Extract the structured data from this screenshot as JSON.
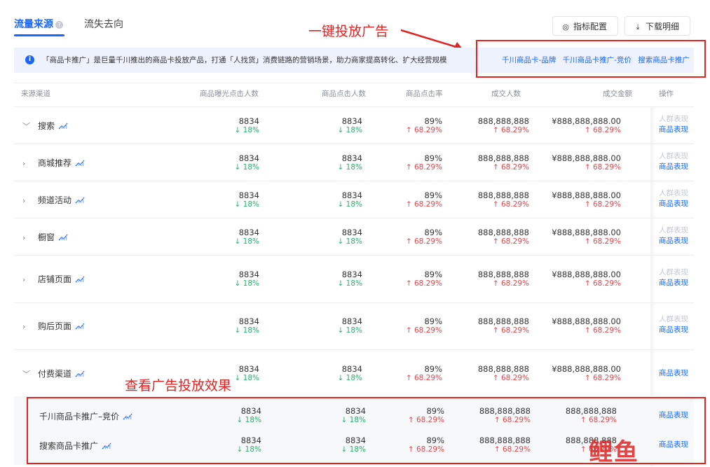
{
  "tabs": [
    {
      "label": "流量来源",
      "active": true
    },
    {
      "label": "流失去向",
      "active": false
    }
  ],
  "toolbar": {
    "metric_label": "指标配置",
    "download_label": "下载明细"
  },
  "annotations": {
    "top": "一键投放广告",
    "bottom": "查看广告投放效果"
  },
  "banner": {
    "text": "「商品卡推广」是巨量千川推出的商品卡投放产品，打通「人找货」消费链路的营销场景，助力商家提高转化、扩大经营规模",
    "links": [
      "千川商品卡-品牌",
      "千川商品卡推广-竞价",
      "搜索商品卡推广"
    ]
  },
  "columns": [
    "来源渠道",
    "商品曝光点击人数",
    "商品点击人数",
    "商品点击率",
    "成交人数",
    "成交金额",
    "操作"
  ],
  "ops": {
    "crowd": "人群表现",
    "product": "商品表现"
  },
  "rows": [
    {
      "name": "搜索",
      "expanded": true,
      "c1": "8834",
      "c1d": "↓ 18%",
      "c2": "8834",
      "c2d": "↓ 18%",
      "c3": "89%",
      "c3d": "↑ 68.29%",
      "c4": "888,888,888",
      "c4d": "↑ 68.29%",
      "c5": "¥888,888,888.00",
      "c5d": "↑ 68.29%"
    },
    {
      "name": "商城推荐",
      "expanded": false,
      "c1": "8834",
      "c1d": "↓ 18%",
      "c2": "8834",
      "c2d": "↓ 18%",
      "c3": "89%",
      "c3d": "↑ 68.29%",
      "c4": "888,888,888",
      "c4d": "↑ 68.29%",
      "c5": "¥888,888,888.00",
      "c5d": "↑ 68.29%"
    },
    {
      "name": "频道活动",
      "expanded": false,
      "c1": "8834",
      "c1d": "↓ 18%",
      "c2": "8834",
      "c2d": "↓ 18%",
      "c3": "89%",
      "c3d": "↑ 68.29%",
      "c4": "888,888,888",
      "c4d": "↑ 68.29%",
      "c5": "¥888,888,888.00",
      "c5d": "↑ 68.29%"
    },
    {
      "name": "橱窗",
      "expanded": false,
      "c1": "8834",
      "c1d": "↓ 18%",
      "c2": "8834",
      "c2d": "↓ 18%",
      "c3": "89%",
      "c3d": "↑ 68.29%",
      "c4": "888,888,888",
      "c4d": "↑ 68.29%",
      "c5": "¥888,888,888.00",
      "c5d": "↑ 68.29%"
    },
    {
      "name": "店铺页面",
      "expanded": false,
      "c1": "8834",
      "c1d": "↓ 18%",
      "c2": "8834",
      "c2d": "↓ 18%",
      "c3": "89%",
      "c3d": "↑ 68.29%",
      "c4": "888,888,888",
      "c4d": "↑ 68.29%",
      "c5": "¥888,888,888.00",
      "c5d": "↑ 68.29%"
    },
    {
      "name": "购后页面",
      "expanded": false,
      "c1": "8834",
      "c1d": "↓ 18%",
      "c2": "8834",
      "c2d": "↓ 18%",
      "c3": "89%",
      "c3d": "↑ 68.29%",
      "c4": "888,888,888",
      "c4d": "↑ 68.29%",
      "c5": "¥888,888,888.00",
      "c5d": "↑ 68.29%"
    },
    {
      "name": "付费渠道",
      "expanded": true,
      "c1": "8834",
      "c1d": "↓ 18%",
      "c2": "8834",
      "c2d": "↓ 18%",
      "c3": "89%",
      "c3d": "↑ 68.29%",
      "c4": "888,888,888",
      "c4d": "↑ 68.29%",
      "c5": "¥888,888,888.00",
      "c5d": "↑ 68.29%"
    }
  ],
  "subrows": [
    {
      "name": "千川商品卡推广–竞价",
      "c1": "8834",
      "c1d": "↓ 18%",
      "c2": "8834",
      "c2d": "↓ 18%",
      "c3": "89%",
      "c3d": "↑ 68.29%",
      "c4": "888,888,888",
      "c4d": "↑ 68.29%",
      "c5": "888,888,888",
      "c5d": "↑ 68.29%"
    },
    {
      "name": "搜索商品卡推广",
      "c1": "8834",
      "c1d": "↓ 18%",
      "c2": "8834",
      "c2d": "↓ 18%",
      "c3": "89%",
      "c3d": "↑ 68.29%",
      "c4": "888,888,888",
      "c4d": "↑ 68.29%",
      "c5": "888,888,888",
      "c5d": "↑ 68.29%"
    }
  ],
  "watermark": "鲤鱼",
  "colors": {
    "accent": "#1966ff",
    "down": "#27b36b",
    "up": "#e8474c",
    "annotation": "#e02424"
  }
}
